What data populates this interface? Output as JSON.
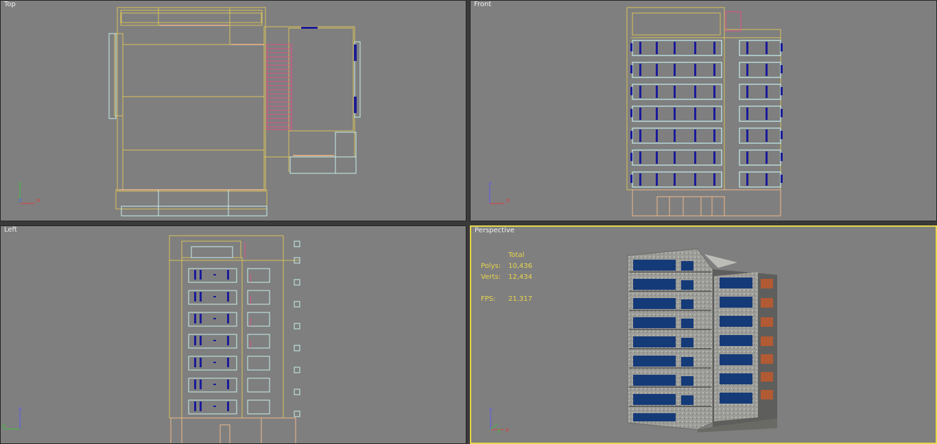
{
  "viewports": {
    "top": {
      "label": "Top"
    },
    "front": {
      "label": "Front"
    },
    "left": {
      "label": "Left"
    },
    "perspective": {
      "label": "Perspective"
    }
  },
  "stats": {
    "header": "Total",
    "polys_label": "Polys:",
    "polys_value": "10,436",
    "verts_label": "Verts:",
    "verts_value": "12,434",
    "fps_label": "FPS:",
    "fps_value": "21.317"
  },
  "axes": {
    "top": {
      "v": "y",
      "h": "x",
      "o": "z"
    },
    "front": {
      "v": "z",
      "h": "x"
    },
    "left": {
      "v": "z",
      "h": "y"
    },
    "persp": {
      "v": "z",
      "h": "x",
      "o": "y"
    }
  },
  "colors": {
    "viewport_bg": "#7f7f7f",
    "active_border": "#e8d84a",
    "stats_text": "#e9d64c",
    "wire_yellow": "#d8c25a",
    "wire_cyan": "#c8f0ee",
    "wire_orange": "#f0b888",
    "wire_pink": "#e0508a",
    "window_blue": "#1a1a9a"
  }
}
